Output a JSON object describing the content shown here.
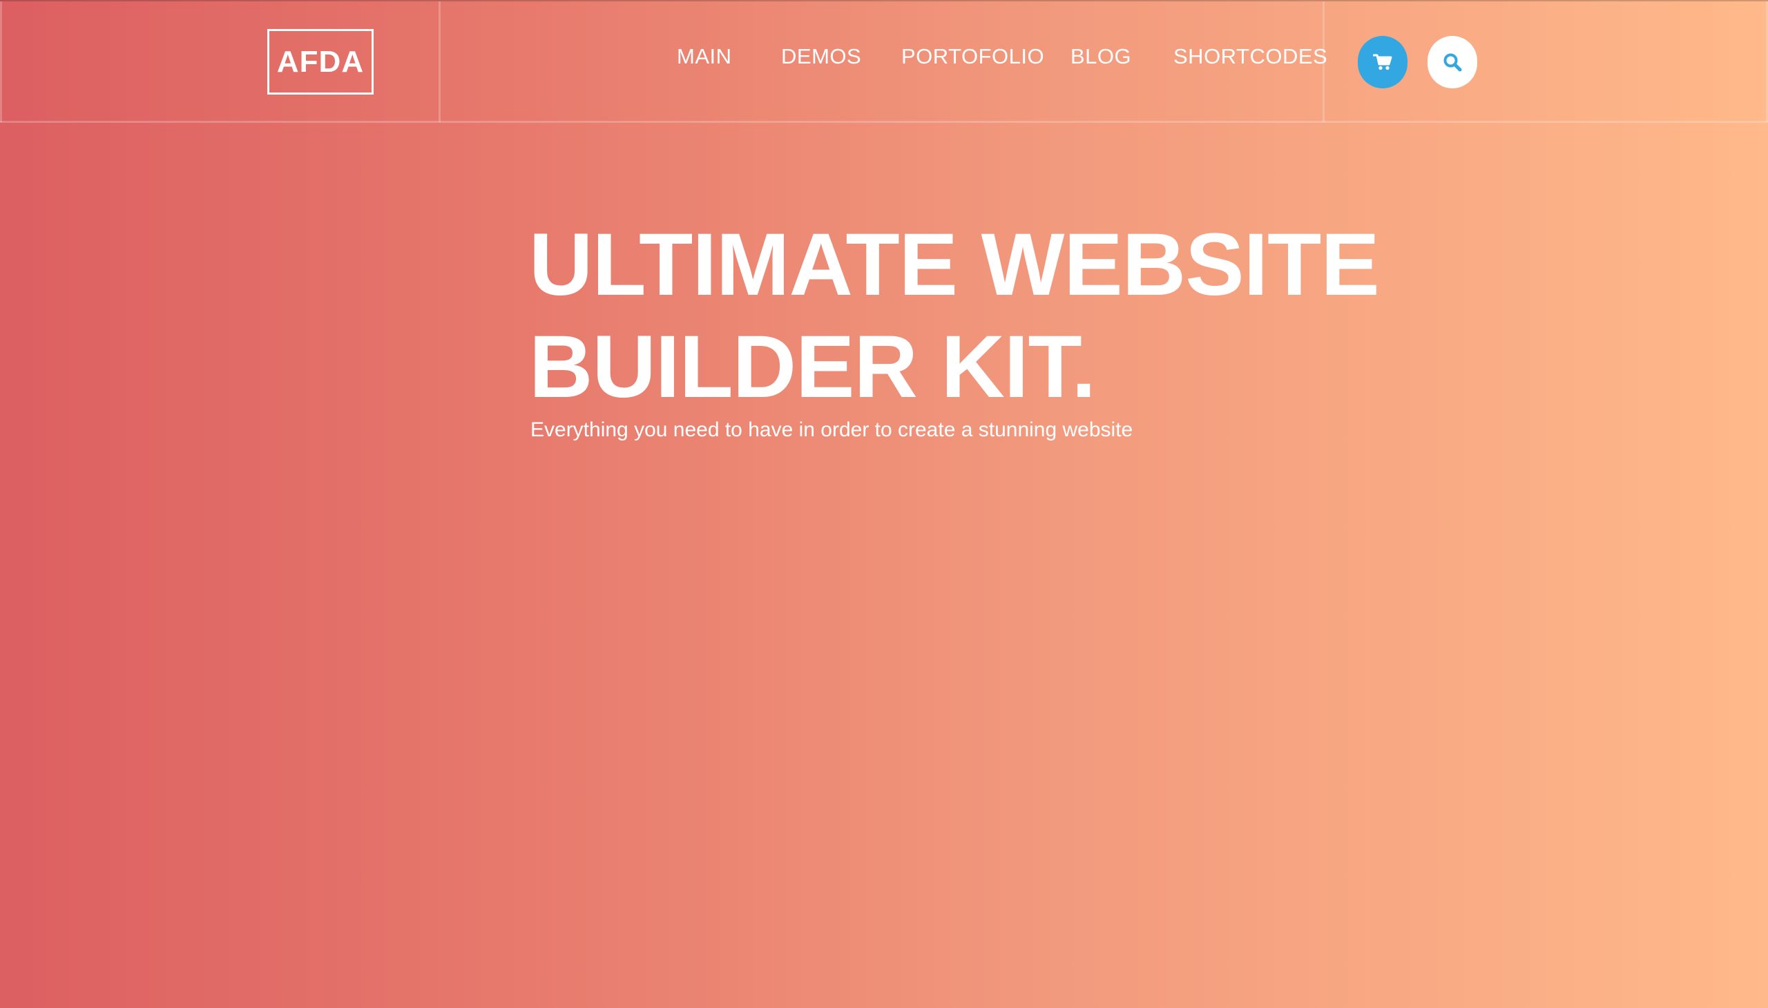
{
  "header": {
    "logo_text": "AFDA",
    "nav": [
      {
        "label": "MAIN"
      },
      {
        "label": "DEMOS"
      },
      {
        "label": "PORTOFOLIO"
      },
      {
        "label": "BLOG"
      },
      {
        "label": "SHORTCODES"
      }
    ],
    "actions": {
      "cart_icon": "cart-icon",
      "search_icon": "search-icon"
    }
  },
  "hero": {
    "title_line1": "ULTIMATE WEBSITE",
    "title_line2": "BUILDER KIT.",
    "subtitle": "Everything you need to have in order to create a stunning website"
  },
  "colors": {
    "gradient_start": "#dc5f61",
    "gradient_end": "#ffb98a",
    "accent_blue": "#32a7e2",
    "text": "#ffffff"
  }
}
